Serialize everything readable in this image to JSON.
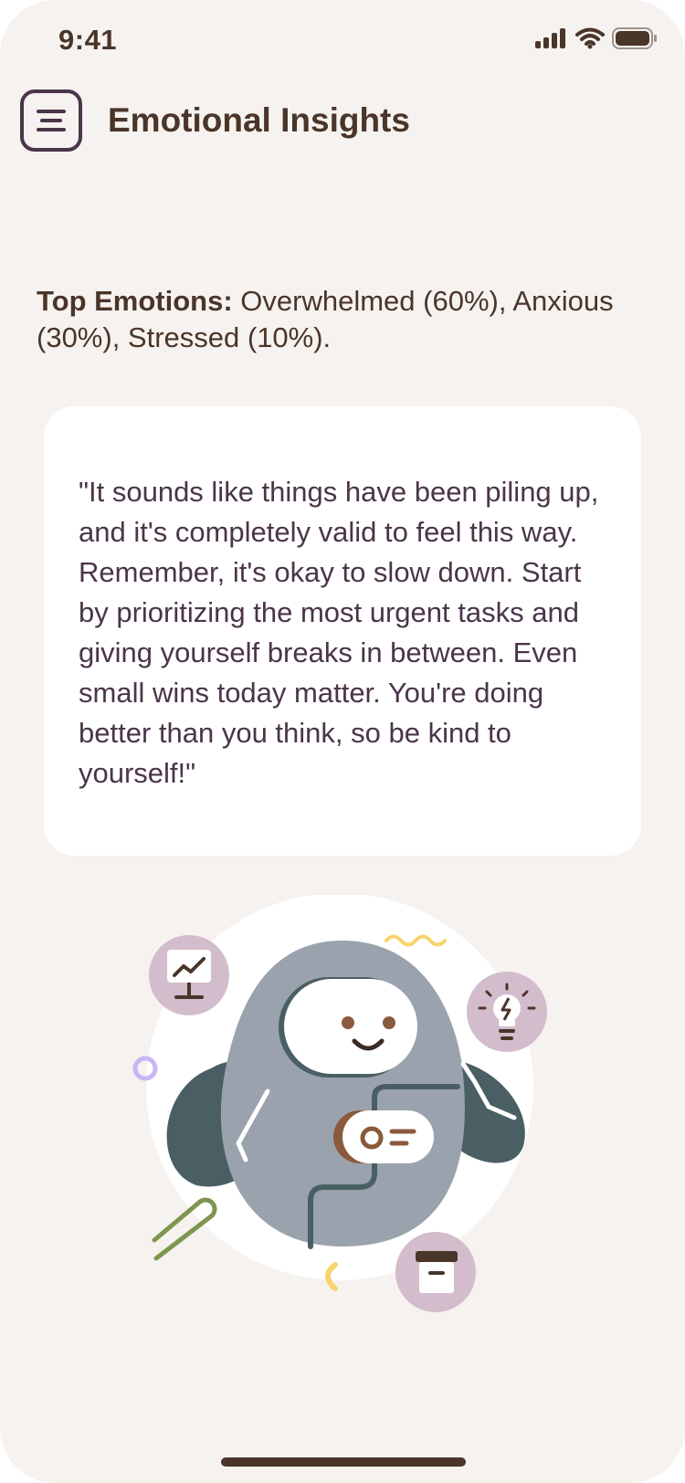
{
  "status_bar": {
    "time": "9:41",
    "icons": [
      "signal-icon",
      "wifi-icon",
      "battery-icon"
    ]
  },
  "header": {
    "menu_icon": "menu-icon",
    "title": "Emotional Insights"
  },
  "insights": {
    "top_emotions_label": "Top Emotions:",
    "top_emotions_text": " Overwhelmed (60%), Anxious (30%), Stressed (10%).",
    "emotions": [
      {
        "name": "Overwhelmed",
        "percent": 60
      },
      {
        "name": "Anxious",
        "percent": 30
      },
      {
        "name": "Stressed",
        "percent": 10
      }
    ]
  },
  "message_card": {
    "quote": "\"It sounds like things have been piling up, and it's completely valid to feel this way. Remember, it's okay to slow down. Start by prioritizing the most urgent tasks and giving yourself breaks in between. Even small wins today matter. You're doing better than you think, so be kind to yourself!\""
  },
  "illustration": {
    "subject": "robot-mascot",
    "badges": [
      "chart-board-icon",
      "lightbulb-icon",
      "archive-box-icon"
    ]
  },
  "colors": {
    "background": "#f6f2ef",
    "text_brown": "#4a3529",
    "text_plum": "#4a3549",
    "card": "#ffffff",
    "robot_body": "#9aa2ad",
    "robot_arm": "#4a5f63",
    "badge": "#d3bccb",
    "accent_yellow": "#f7d46a",
    "accent_green": "#7e9650",
    "accent_lilac": "#c9b5f5"
  }
}
